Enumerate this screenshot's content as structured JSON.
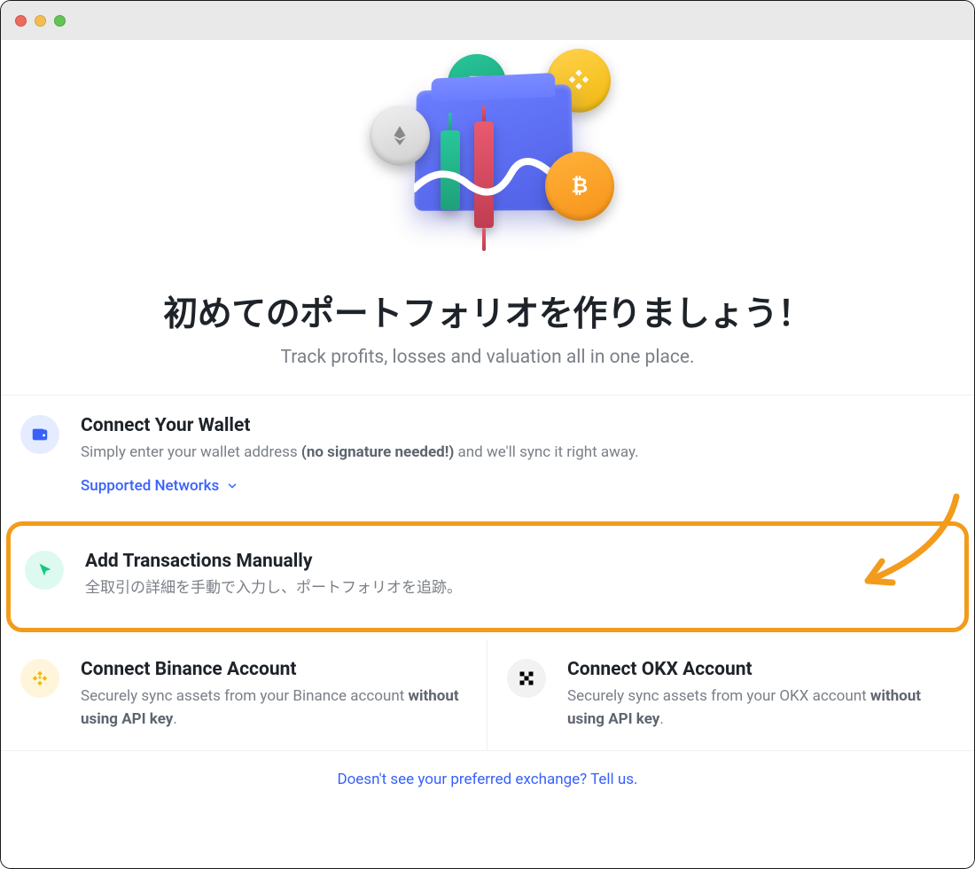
{
  "heading": "初めてのポートフォリオを作りましょう！",
  "subheading": "Track profits, losses and valuation all in one place.",
  "options": {
    "wallet": {
      "title": "Connect Your Wallet",
      "desc_pre": "Simply enter your wallet address ",
      "desc_bold": "(no signature needed!)",
      "desc_post": " and we'll sync it right away.",
      "supported_label": "Supported Networks"
    },
    "manual": {
      "title": "Add Transactions Manually",
      "desc": "全取引の詳細を手動で入力し、ポートフォリオを追跡。"
    },
    "binance": {
      "title": "Connect Binance Account",
      "desc_pre": "Securely sync assets from your Binance account ",
      "desc_bold": "without using API key",
      "desc_post": "."
    },
    "okx": {
      "title": "Connect OKX Account",
      "desc_pre": "Securely sync assets from your OKX account ",
      "desc_bold": "without using API key",
      "desc_post": "."
    }
  },
  "footer": {
    "link_text": "Doesn't see your preferred exchange? Tell us."
  },
  "colors": {
    "accent": "#3861fb",
    "highlight_border": "#f39b1b"
  }
}
